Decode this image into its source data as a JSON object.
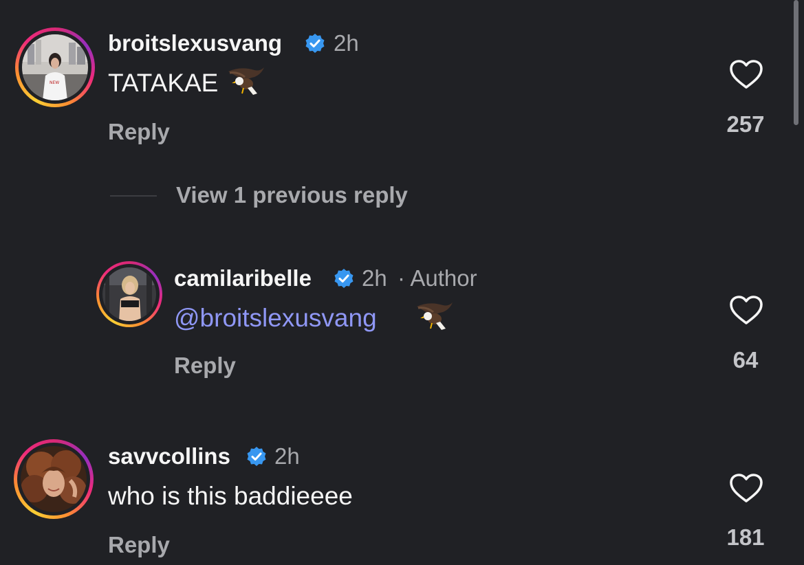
{
  "comments": [
    {
      "username": "broitslexusvang",
      "time": "2h",
      "text": "TATAKAE",
      "emoji": "eagle-emoji",
      "reply_label": "Reply",
      "likes": "257"
    },
    {
      "username": "camilaribelle",
      "time": "2h",
      "author_tag": "· Author",
      "mention": "@broitslexusvang",
      "emoji": "eagle-emoji",
      "reply_label": "Reply",
      "likes": "64"
    },
    {
      "username": "savvcollins",
      "time": "2h",
      "text": "who is this baddieeee",
      "reply_label": "Reply",
      "likes": "181"
    }
  ],
  "thread": {
    "view_previous": "View 1 previous reply"
  },
  "colors": {
    "background": "#202125",
    "verified_badge": "#3897f0",
    "mention": "#8f97f5",
    "secondary_text": "#a8a9ad"
  }
}
